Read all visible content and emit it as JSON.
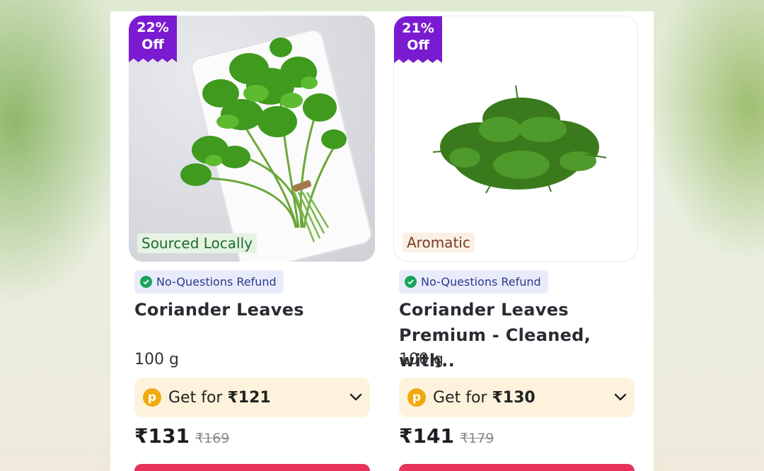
{
  "products": [
    {
      "discount_pct": "22%",
      "discount_off": "Off",
      "tag": "Sourced Locally",
      "refund_label": "No-Questions Refund",
      "name": "Coriander Leaves",
      "weight": "100 g",
      "getfor_prefix": "Get for ",
      "getfor_price": "₹121",
      "price": "₹131",
      "mrp": "₹169"
    },
    {
      "discount_pct": "21%",
      "discount_off": "Off",
      "tag": "Aromatic",
      "refund_label": "No-Questions Refund",
      "name": "Coriander Leaves Premium - Cleaned, with..",
      "weight": "100 g",
      "getfor_prefix": "Get for ",
      "getfor_price": "₹130",
      "price": "₹141",
      "mrp": "₹179"
    }
  ],
  "colors": {
    "discount_badge": "#7a1bd1",
    "refund_bg": "#e8ecfa",
    "getfor_bg": "#fdf3dc",
    "add_button": "#e8345d"
  },
  "icons": {
    "check": "check-circle-icon",
    "coin": "p-coin-icon",
    "chevron": "chevron-down-icon"
  }
}
